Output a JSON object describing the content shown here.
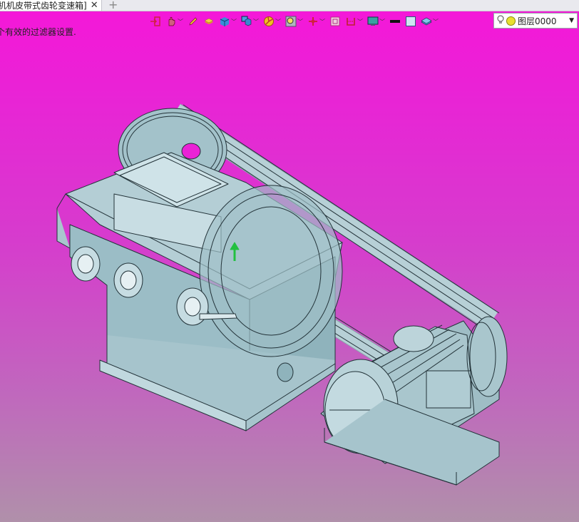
{
  "tab": {
    "title": "机机皮带式齿轮变速箱]",
    "close_glyph": "✕",
    "add_glyph": "+"
  },
  "viewport": {
    "message": "个有效的过滤器设置.",
    "background_top": "#f418d8",
    "background_bottom": "#b090aa"
  },
  "toolbar": {
    "tools": [
      {
        "icon": "import-icon",
        "has_dropdown": false
      },
      {
        "icon": "hand-pointer-icon",
        "has_dropdown": true
      },
      {
        "icon": "pencil-icon",
        "has_dropdown": false
      },
      {
        "icon": "stack-icon",
        "has_dropdown": false
      },
      {
        "icon": "cube-icon",
        "has_dropdown": true
      },
      {
        "icon": "views-icon",
        "has_dropdown": true
      },
      {
        "icon": "render-icon",
        "has_dropdown": true
      },
      {
        "icon": "zoom-icon",
        "has_dropdown": true
      },
      {
        "icon": "axis-icon",
        "has_dropdown": true
      },
      {
        "icon": "frame-icon",
        "has_dropdown": false
      },
      {
        "icon": "section-icon",
        "has_dropdown": true
      },
      {
        "icon": "monitor-icon",
        "has_dropdown": true
      },
      {
        "icon": "line-color-icon",
        "has_dropdown": false
      },
      {
        "icon": "fill-color-icon",
        "has_dropdown": false
      },
      {
        "icon": "layer-icon",
        "has_dropdown": true
      }
    ],
    "layer": {
      "label": "图层0000",
      "icon": "bulb-icon",
      "color": "#e8e030"
    }
  },
  "model": {
    "body_color": "#9bbdc6",
    "edge_color": "#223238"
  }
}
